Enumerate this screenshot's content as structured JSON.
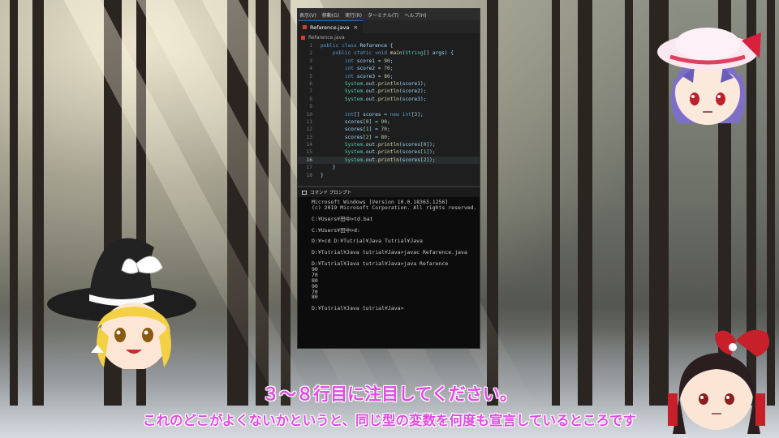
{
  "editor": {
    "menu": [
      "表示(V)",
      "移動(G)",
      "実行(R)",
      "ターミナル(T)",
      "ヘルプ(H)"
    ],
    "tab_label": "Refarence.java",
    "tab_close": "×",
    "file_crumb": "Refarence.java",
    "active_line": 16,
    "lines": [
      {
        "n": "1",
        "t": "public class Refarence {"
      },
      {
        "n": "2",
        "t": "    public static void main(String[] args) {"
      },
      {
        "n": "3",
        "t": "        int score1 = 90;"
      },
      {
        "n": "4",
        "t": "        int score2 = 70;"
      },
      {
        "n": "5",
        "t": "        int score3 = 80;"
      },
      {
        "n": "6",
        "t": "        System.out.println(score1);"
      },
      {
        "n": "7",
        "t": "        System.out.println(score2);"
      },
      {
        "n": "8",
        "t": "        System.out.println(score3);"
      },
      {
        "n": "9",
        "t": ""
      },
      {
        "n": "10",
        "t": "        int[] scores = new int[3];"
      },
      {
        "n": "11",
        "t": "        scores[0] = 90;"
      },
      {
        "n": "12",
        "t": "        scores[1] = 70;"
      },
      {
        "n": "13",
        "t": "        scores[2] = 80;"
      },
      {
        "n": "14",
        "t": "        System.out.println(scores[0]);"
      },
      {
        "n": "15",
        "t": "        System.out.println(scores[1]);"
      },
      {
        "n": "16",
        "t": "        System.out.println(scores[2]);"
      },
      {
        "n": "17",
        "t": "    }"
      },
      {
        "n": "18",
        "t": "}"
      }
    ]
  },
  "cmd": {
    "title": "コマンド プロンプト",
    "output": "Microsoft Windows [Version 10.0.18363.1256]\n(c) 2019 Microsoft Corporation. All rights reserved.\n\nC:¥Users¥田中>td.bat\n\nC:¥Users¥田中>d:\n\nD:¥>cd D:¥Tutrial¥Java Tutrial¥Java\n\nD:¥Tutrial¥Java tutrial¥Java>javac Refarence.java\n\nD:¥Tutrial¥Java tutrial¥Java>java Refarence\n90\n70\n80\n90\n70\n80\n\nD:¥Tutrial¥Java tutrial¥Java>"
  },
  "subtitles": {
    "line1": "３～８行目に注目してください。",
    "line2": "これのどこがよくないかというと、同じ型の変数を何度も宣言しているところです"
  },
  "colors": {
    "subtitle": "#e24ae4",
    "keyword": "#569cd6",
    "type": "#4ec9b0",
    "number": "#b5cea8",
    "func": "#dcdcaa"
  },
  "characters": [
    "remilia-avatar",
    "marisa-avatar",
    "reimu-avatar"
  ]
}
